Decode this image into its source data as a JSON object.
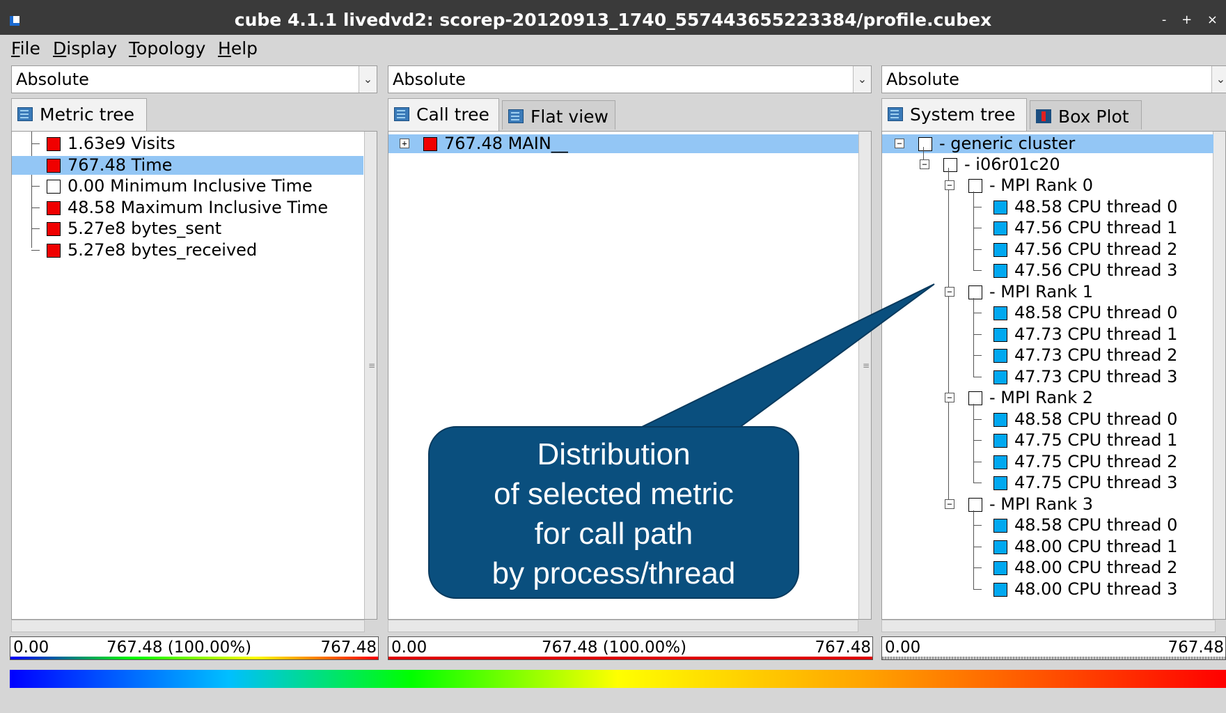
{
  "window": {
    "title": "cube 4.1.1 livedvd2: scorep-20120913_1740_557443655223384/profile.cubex",
    "controls": "- + ×"
  },
  "menu": [
    {
      "label": "File",
      "accel": "F",
      "rest": "ile"
    },
    {
      "label": "Display",
      "accel": "D",
      "rest": "isplay"
    },
    {
      "label": "Topology",
      "accel": "T",
      "rest": "opology"
    },
    {
      "label": "Help",
      "accel": "H",
      "rest": "elp"
    }
  ],
  "metric_panel": {
    "mode": "Absolute",
    "tabs": [
      {
        "label": "Metric tree",
        "icon": "tree-icon"
      }
    ],
    "rows": [
      {
        "value": "1.63e9",
        "name": "Visits",
        "color": "red"
      },
      {
        "value": "767.48",
        "name": "Time",
        "color": "red",
        "selected": true
      },
      {
        "value": "0.00",
        "name": "Minimum Inclusive Time",
        "color": "white"
      },
      {
        "value": "48.58",
        "name": "Maximum Inclusive Time",
        "color": "red"
      },
      {
        "value": "5.27e8",
        "name": "bytes_sent",
        "color": "red"
      },
      {
        "value": "5.27e8",
        "name": "bytes_received",
        "color": "red"
      }
    ],
    "scale": {
      "min": "0.00",
      "mid": "767.48 (100.00%)",
      "max": "767.48"
    }
  },
  "call_panel": {
    "mode": "Absolute",
    "tabs": [
      {
        "label": "Call tree",
        "icon": "tree-icon"
      },
      {
        "label": "Flat view",
        "icon": "list-icon"
      }
    ],
    "rows": [
      {
        "value": "767.48",
        "name": "MAIN__",
        "color": "red",
        "selected": true
      }
    ],
    "scale": {
      "min": "0.00",
      "mid": "767.48 (100.00%)",
      "max": "767.48"
    }
  },
  "system_panel": {
    "mode": "Absolute",
    "tabs": [
      {
        "label": "System tree",
        "icon": "tree-icon"
      },
      {
        "label": "Box Plot",
        "icon": "boxplot-icon"
      }
    ],
    "cluster": "- generic cluster",
    "node": "- i06r01c20",
    "ranks": [
      {
        "label": "- MPI Rank 0",
        "threads": [
          {
            "value": "48.58",
            "name": "CPU thread 0"
          },
          {
            "value": "47.56",
            "name": "CPU thread 1"
          },
          {
            "value": "47.56",
            "name": "CPU thread 2"
          },
          {
            "value": "47.56",
            "name": "CPU thread 3"
          }
        ]
      },
      {
        "label": "- MPI Rank 1",
        "threads": [
          {
            "value": "48.58",
            "name": "CPU thread 0"
          },
          {
            "value": "47.73",
            "name": "CPU thread 1"
          },
          {
            "value": "47.73",
            "name": "CPU thread 2"
          },
          {
            "value": "47.73",
            "name": "CPU thread 3"
          }
        ]
      },
      {
        "label": "- MPI Rank 2",
        "threads": [
          {
            "value": "48.58",
            "name": "CPU thread 0"
          },
          {
            "value": "47.75",
            "name": "CPU thread 1"
          },
          {
            "value": "47.75",
            "name": "CPU thread 2"
          },
          {
            "value": "47.75",
            "name": "CPU thread 3"
          }
        ]
      },
      {
        "label": "- MPI Rank 3",
        "threads": [
          {
            "value": "48.58",
            "name": "CPU thread 0"
          },
          {
            "value": "48.00",
            "name": "CPU thread 1"
          },
          {
            "value": "48.00",
            "name": "CPU thread 2"
          },
          {
            "value": "48.00",
            "name": "CPU thread 3"
          }
        ]
      }
    ],
    "scale": {
      "min": "0.00",
      "max": "767.48"
    }
  },
  "callout": {
    "lines": [
      "Distribution",
      "of selected metric",
      "for call path",
      "by process/thread"
    ]
  },
  "colors": {
    "selected": "#93c6f5",
    "callout": "#0a4f7e",
    "metric_red": "#f00000",
    "thread_cyan": "#00a8f0"
  }
}
